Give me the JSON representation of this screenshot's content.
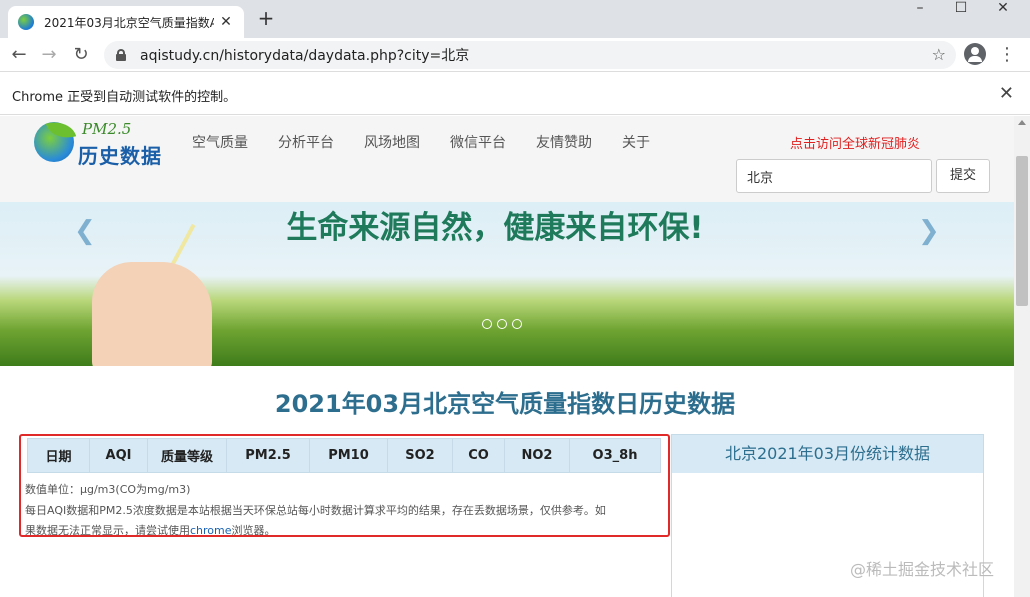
{
  "browser": {
    "tab_title": "2021年03月北京空气质量指数A",
    "url": "aqistudy.cn/historydata/daydata.php?city=北京",
    "infobar_text": "Chrome 正受到自动测试软件的控制。"
  },
  "site": {
    "logo_sub": "PM2.5",
    "logo_main": "历史数据",
    "nav": [
      "空气质量",
      "分析平台",
      "风场地图",
      "微信平台",
      "友情赞助",
      "关于"
    ],
    "promo_link": "点击访问全球新冠肺炎",
    "city_value": "北京",
    "submit_label": "提交"
  },
  "banner": {
    "slogan": "生命来源自然，健康来自环保!"
  },
  "main": {
    "title": "2021年03月北京空气质量指数日历史数据",
    "table_headers": [
      "日期",
      "AQI",
      "质量等级",
      "PM2.5",
      "PM10",
      "SO2",
      "CO",
      "NO2",
      "O3_8h"
    ],
    "note_unit": "数值单位：μg/m3(CO为mg/m3)",
    "note_line2": "每日AQI数据和PM2.5浓度数据是本站根据当天环保总站每小时数据计算求平均的结果，存在丢数据场景，仅供参考。如",
    "note_line3_prefix": "果数据无法正常显示，请尝试使用",
    "note_line3_link": "chrome",
    "note_line3_suffix": "浏览器。"
  },
  "stats": {
    "title": "北京2021年03月份统计数据"
  },
  "watermark": "@稀土掘金技术社区"
}
